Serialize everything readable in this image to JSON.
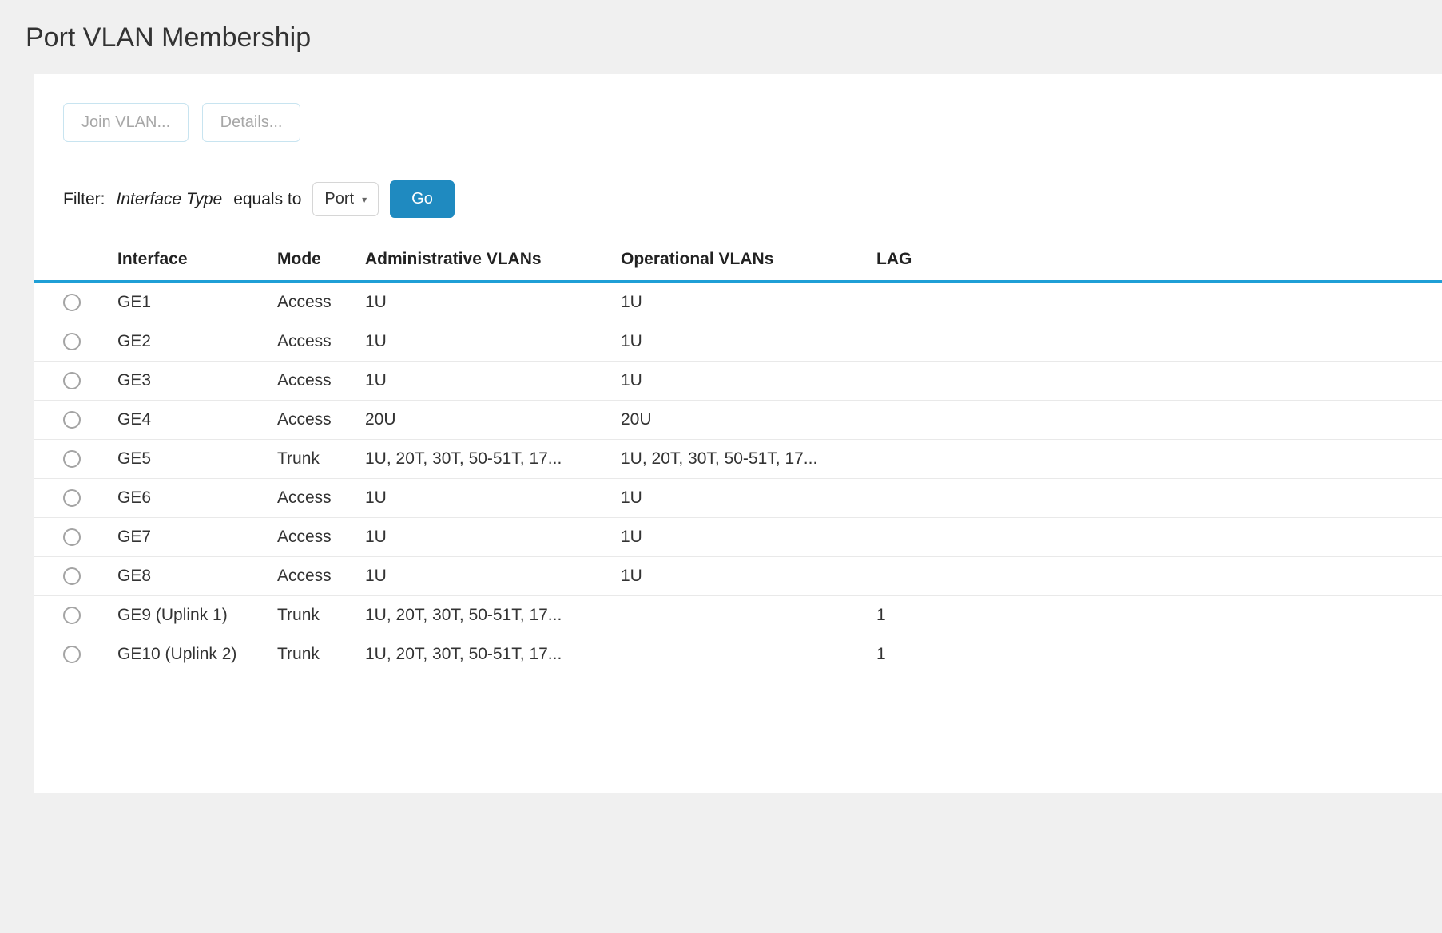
{
  "header": {
    "title": "Port VLAN Membership"
  },
  "toolbar": {
    "join_vlan_label": "Join VLAN...",
    "details_label": "Details..."
  },
  "filter": {
    "label": "Filter:",
    "field_label": "Interface Type",
    "operator_label": "equals to",
    "selected_value": "Port",
    "go_label": "Go"
  },
  "table": {
    "headers": {
      "interface": "Interface",
      "mode": "Mode",
      "admin_vlans": "Administrative VLANs",
      "oper_vlans": "Operational VLANs",
      "lag": "LAG"
    },
    "rows": [
      {
        "interface": "GE1",
        "mode": "Access",
        "admin": "1U",
        "oper": "1U",
        "lag": ""
      },
      {
        "interface": "GE2",
        "mode": "Access",
        "admin": "1U",
        "oper": "1U",
        "lag": ""
      },
      {
        "interface": "GE3",
        "mode": "Access",
        "admin": "1U",
        "oper": "1U",
        "lag": ""
      },
      {
        "interface": "GE4",
        "mode": "Access",
        "admin": "20U",
        "oper": "20U",
        "lag": ""
      },
      {
        "interface": "GE5",
        "mode": "Trunk",
        "admin": "1U, 20T, 30T, 50-51T, 17...",
        "oper": "1U, 20T, 30T, 50-51T, 17...",
        "lag": ""
      },
      {
        "interface": "GE6",
        "mode": "Access",
        "admin": "1U",
        "oper": "1U",
        "lag": ""
      },
      {
        "interface": "GE7",
        "mode": "Access",
        "admin": "1U",
        "oper": "1U",
        "lag": ""
      },
      {
        "interface": "GE8",
        "mode": "Access",
        "admin": "1U",
        "oper": "1U",
        "lag": ""
      },
      {
        "interface": "GE9 (Uplink 1)",
        "mode": "Trunk",
        "admin": "1U, 20T, 30T, 50-51T, 17...",
        "oper": "",
        "lag": "1"
      },
      {
        "interface": "GE10 (Uplink 2)",
        "mode": "Trunk",
        "admin": "1U, 20T, 30T, 50-51T, 17...",
        "oper": "",
        "lag": "1"
      }
    ]
  }
}
